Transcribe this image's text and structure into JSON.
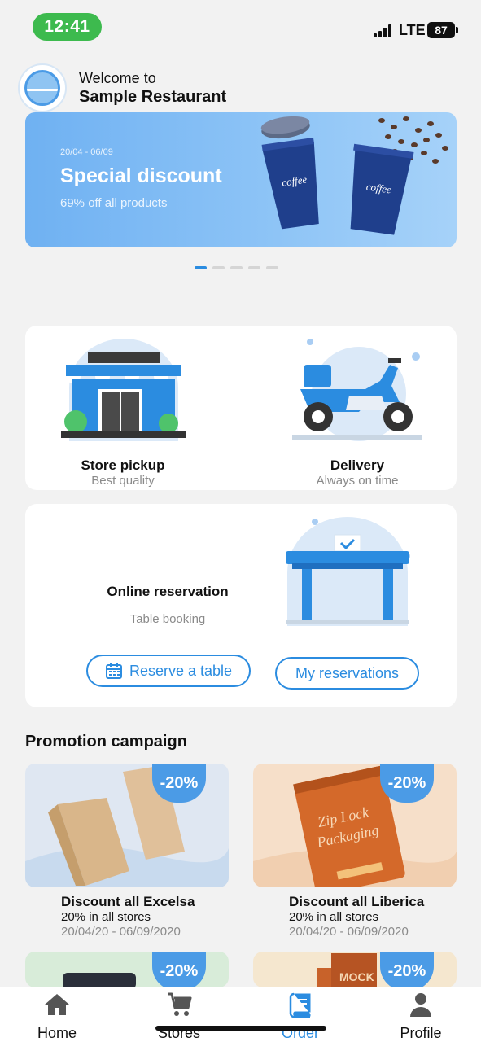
{
  "status_bar": {
    "time": "12:41",
    "network": "LTE",
    "battery": "87"
  },
  "header": {
    "welcome": "Welcome to",
    "restaurant": "Sample Restaurant"
  },
  "banner": {
    "date": "20/04 - 06/09",
    "title": "Special discount",
    "subtitle": "69% off all products",
    "slide_count": 5,
    "active_slide": 1
  },
  "services": {
    "pickup": {
      "label": "Store pickup",
      "sub": "Best quality"
    },
    "delivery": {
      "label": "Delivery",
      "sub": "Always on time"
    },
    "reservation": {
      "label": "Online reservation",
      "sub": "Table booking",
      "reserve_button": "Reserve a table",
      "my_button": "My reservations"
    }
  },
  "promotions": {
    "title": "Promotion campaign",
    "items": [
      {
        "badge": "-20%",
        "title": "Discount all Excelsa",
        "sub": "20% in all stores",
        "date": "20/04/20 - 06/09/2020"
      },
      {
        "badge": "-20%",
        "title": "Discount all Liberica",
        "sub": "20% in all stores",
        "date": "20/04/20 - 06/09/2020"
      },
      {
        "badge": "-20%"
      },
      {
        "badge": "-20%"
      }
    ]
  },
  "nav": {
    "active": "Order",
    "items": [
      {
        "label": "Home",
        "icon": "home-icon"
      },
      {
        "label": "Stores",
        "icon": "cart-icon"
      },
      {
        "label": "Order",
        "icon": "book-icon"
      },
      {
        "label": "Profile",
        "icon": "person-icon"
      }
    ]
  },
  "colors": {
    "accent": "#2b8ce0",
    "status_pill": "#3dba4e",
    "badge": "#4b9be6"
  }
}
